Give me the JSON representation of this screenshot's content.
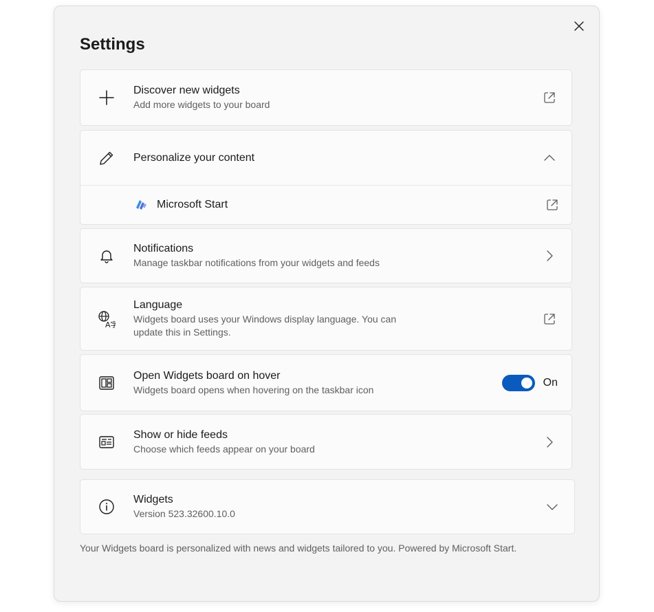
{
  "title": "Settings",
  "close_icon": "close-icon",
  "items": {
    "discover": {
      "icon": "plus-icon",
      "title": "Discover new widgets",
      "subtitle": "Add more widgets to your board",
      "trail_icon": "open-external-icon"
    },
    "personalize": {
      "icon": "pencil-icon",
      "title": "Personalize your content",
      "trail_icon": "chevron-up-icon",
      "sub_item": {
        "icon": "microsoft-start-icon",
        "label": "Microsoft Start",
        "trail_icon": "open-external-icon"
      }
    },
    "notifications": {
      "icon": "bell-icon",
      "title": "Notifications",
      "subtitle": "Manage taskbar notifications from your widgets and feeds",
      "trail_icon": "chevron-right-icon"
    },
    "language": {
      "icon": "language-icon",
      "title": "Language",
      "subtitle_line1": "Widgets board uses your Windows display language. You can",
      "subtitle_line2": "update this in Settings.",
      "trail_icon": "open-external-icon"
    },
    "hover": {
      "icon": "widgets-board-icon",
      "title": "Open Widgets board on hover",
      "subtitle": "Widgets board opens when hovering on the taskbar icon",
      "toggle_state": "On",
      "toggle_on": true,
      "accent": "#0a5bbd"
    },
    "feeds": {
      "icon": "feed-icon",
      "title": "Show or hide feeds",
      "subtitle": "Choose which feeds appear on your board",
      "trail_icon": "chevron-right-icon"
    },
    "about": {
      "icon": "info-icon",
      "title": "Widgets",
      "subtitle": "Version 523.32600.10.0",
      "trail_icon": "chevron-down-icon"
    }
  },
  "footer": "Your Widgets board is personalized with news and widgets tailored to you. Powered by Microsoft Start."
}
